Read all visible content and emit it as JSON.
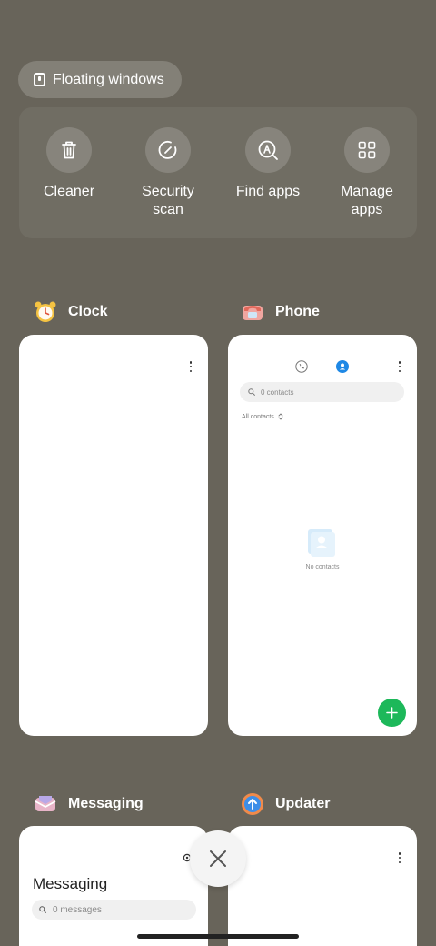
{
  "floating_windows": {
    "label": "Floating windows"
  },
  "tools": [
    {
      "label": "Cleaner",
      "icon": "trash-icon"
    },
    {
      "label": "Security scan",
      "icon": "shield-scan-icon"
    },
    {
      "label": "Find apps",
      "icon": "find-apps-icon"
    },
    {
      "label": "Manage apps",
      "icon": "grid-icon"
    }
  ],
  "apps": {
    "clock": {
      "name": "Clock",
      "icon": "alarm-clock-icon"
    },
    "phone": {
      "name": "Phone",
      "icon": "phone-app-icon",
      "search_placeholder": "0 contacts",
      "filter_label": "All contacts",
      "empty_text": "No contacts"
    },
    "messaging": {
      "name": "Messaging",
      "icon": "messaging-app-icon",
      "title": "Messaging",
      "search_placeholder": "0 messages"
    },
    "updater": {
      "name": "Updater",
      "icon": "updater-app-icon"
    }
  },
  "colors": {
    "background": "#68645a",
    "fab": "#1db85a",
    "accent": "#1e88e5"
  }
}
